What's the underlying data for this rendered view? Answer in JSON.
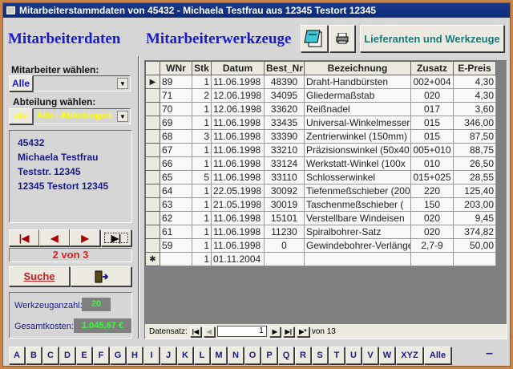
{
  "window": {
    "title": "Mitarbeiterstammdaten von 45432 - Michaela Testfrau aus 12345 Testort 12345"
  },
  "left": {
    "heading": "Mitarbeiterdaten",
    "employee_label": "Mitarbeiter wählen:",
    "employee_button": "Alle",
    "employee_value": "",
    "department_label": "Abteilung wählen:",
    "department_button": "alle",
    "department_value": "Alle - Abteilungen",
    "info": [
      "45432",
      "Michaela Testfrau",
      "Teststr. 12345",
      "12345 Testort 12345"
    ],
    "record_status": "2 von 3",
    "search_button": "Suche",
    "tool_count_label": "Werkzeuganzahl:",
    "tool_count": "20",
    "total_cost_label": "Gesamtkosten:",
    "total_cost": "1.045,67 €"
  },
  "right": {
    "heading": "Mitarbeiterwerkzeuge",
    "suppliers_button": "Lieferanten und Werkzeuge",
    "columns": [
      "WNr",
      "Stk",
      "Datum",
      "Best_Nr",
      "Bezeichnung",
      "Zusatz",
      "E-Preis"
    ],
    "rows": [
      [
        "89",
        "1",
        "11.06.1998",
        "48390",
        "Draht-Handbürsten",
        "002+004",
        "4,30"
      ],
      [
        "71",
        "2",
        "12.06.1998",
        "34095",
        "Gliedermaßstab",
        "020",
        "4,30"
      ],
      [
        "70",
        "1",
        "12.06.1998",
        "33620",
        "Reißnadel",
        "017",
        "3,60"
      ],
      [
        "69",
        "1",
        "11.06.1998",
        "33435",
        "Universal-Winkelmesser",
        "015",
        "346,00"
      ],
      [
        "68",
        "3",
        "11.06.1998",
        "33390",
        "Zentrierwinkel (150mm)",
        "015",
        "87,50"
      ],
      [
        "67",
        "1",
        "11.06.1998",
        "33210",
        "Präzisionswinkel (50x40",
        "005+010",
        "88,75"
      ],
      [
        "66",
        "1",
        "11.06.1998",
        "33124",
        "Werkstatt-Winkel (100x",
        "010",
        "26,50"
      ],
      [
        "65",
        "5",
        "11.06.1998",
        "33110",
        "Schlosserwinkel",
        "015+025",
        "28,55"
      ],
      [
        "64",
        "1",
        "22.05.1998",
        "30092",
        "Tiefenmeßschieber (200",
        "220",
        "125,40"
      ],
      [
        "63",
        "1",
        "21.05.1998",
        "30019",
        "Taschenmeßschieber (",
        "150",
        "203,00"
      ],
      [
        "62",
        "1",
        "11.06.1998",
        "15101",
        "Verstellbare Windeisen",
        "020",
        "9,45"
      ],
      [
        "61",
        "1",
        "11.06.1998",
        "11230",
        "Spiralbohrer-Satz",
        "020",
        "374,82"
      ],
      [
        "59",
        "1",
        "11.06.1998",
        "0",
        "Gewindebohrer-Verlängerung",
        "2,7-9",
        "50,00"
      ]
    ],
    "new_row": [
      "",
      "1",
      "01.11.2004",
      "",
      "",
      "",
      ""
    ],
    "nav_label": "Datensatz:",
    "nav_current": "1",
    "nav_total": "von  13"
  },
  "alphabet": [
    "A",
    "B",
    "C",
    "D",
    "E",
    "F",
    "G",
    "H",
    "I",
    "J",
    "K",
    "L",
    "M",
    "N",
    "O",
    "P",
    "Q",
    "R",
    "S",
    "T",
    "U",
    "V",
    "W",
    "XYZ",
    "Alle"
  ],
  "minimize": "–"
}
